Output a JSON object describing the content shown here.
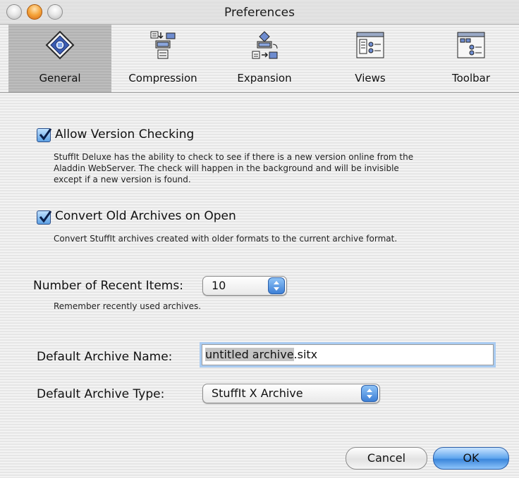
{
  "window": {
    "title": "Preferences"
  },
  "toolbar": {
    "tabs": [
      {
        "label": "General",
        "icon": "general-icon",
        "selected": true
      },
      {
        "label": "Compression",
        "icon": "compression-icon",
        "selected": false
      },
      {
        "label": "Expansion",
        "icon": "expansion-icon",
        "selected": false
      },
      {
        "label": "Views",
        "icon": "views-icon",
        "selected": false
      },
      {
        "label": "Toolbar",
        "icon": "toolbar-icon",
        "selected": false
      }
    ]
  },
  "options": {
    "version_check": {
      "label": "Allow Version Checking",
      "checked": true,
      "desc_lines": [
        "StuffIt Deluxe has the ability to check to see if there is a new version online from the",
        "Aladdin WebServer.  The check will happen in the background and will be invisible",
        "except if a new version is found."
      ]
    },
    "convert_old": {
      "label": "Convert Old Archives on Open",
      "checked": true,
      "desc": "Convert StuffIt archives created with older formats to the current archive format."
    }
  },
  "recent": {
    "label": "Number of Recent Items:",
    "value": "10",
    "desc": "Remember recently used archives."
  },
  "archive_name": {
    "label": "Default Archive Name:",
    "selected_part": "untitled archive",
    "rest": ".sitx"
  },
  "archive_type": {
    "label": "Default Archive Type:",
    "value": "StuffIt X Archive"
  },
  "buttons": {
    "cancel": "Cancel",
    "ok": "OK"
  },
  "colors": {
    "accent": "#3b86db",
    "selection": "#c4c4c4"
  }
}
